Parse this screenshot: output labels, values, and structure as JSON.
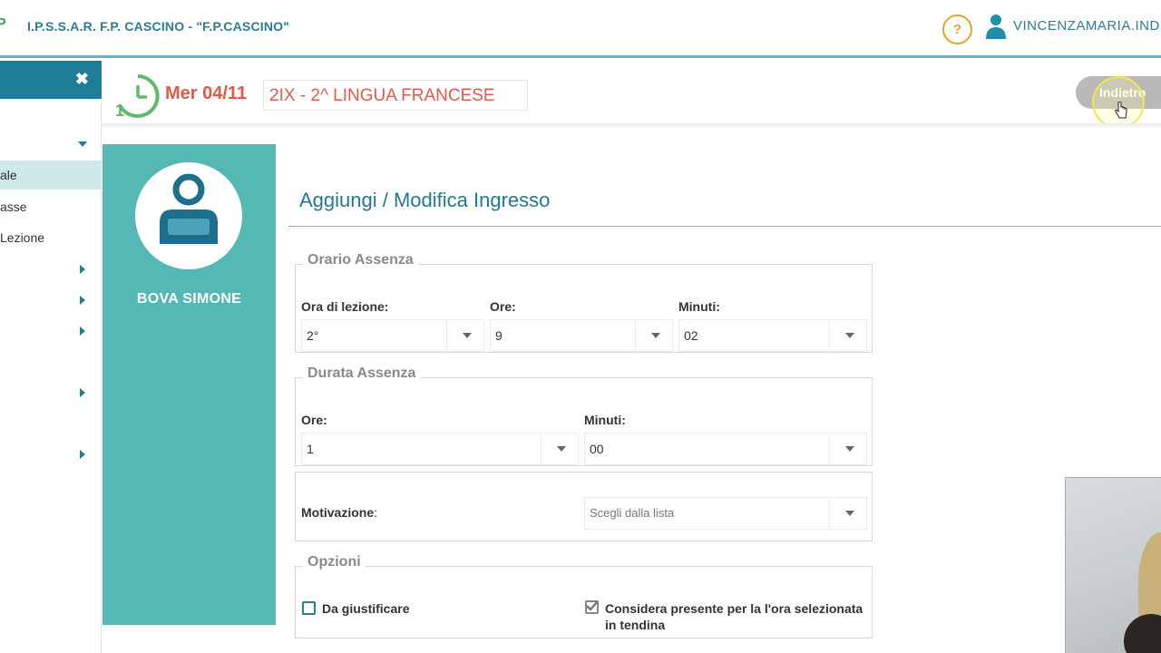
{
  "topbar": {
    "school_name": "I.P.S.S.A.R. F.P. CASCINO - \"F.P.CASCINO\"",
    "help_label": "?",
    "user_name": "VINCENZAMARIA.IND"
  },
  "sidebar": {
    "close_label": "✖",
    "items": [
      {
        "label": "ale",
        "active": true
      },
      {
        "label": "asse",
        "active": false
      },
      {
        "label": "Lezione",
        "active": false
      }
    ]
  },
  "header": {
    "date": "Mer 04/11",
    "class_name": "2IX - 2^ LINGUA FRANCESE",
    "back_label": "Indietro",
    "clock_icon": "clock-1-icon"
  },
  "student": {
    "name": "BOVA SIMONE",
    "avatar_icon": "user-avatar-icon"
  },
  "form": {
    "title": "Aggiungi / Modifica Ingresso",
    "orario": {
      "legend": "Orario Assenza",
      "lesson_label": "Ora di lezione:",
      "lesson_value": "2°",
      "hours_label": "Ore:",
      "hours_value": "9",
      "minutes_label": "Minuti:",
      "minutes_value": "02"
    },
    "durata": {
      "legend": "Durata Assenza",
      "hours_label": "Ore:",
      "hours_value": "1",
      "minutes_label": "Minuti:",
      "minutes_value": "00"
    },
    "motivazione": {
      "label": "Motivazione",
      "colon": ":",
      "placeholder": "Scegli dalla lista"
    },
    "opzioni": {
      "legend": "Opzioni",
      "to_justify_label": "Da giustificare",
      "to_justify_checked": false,
      "consider_present_label_1": "Considera presente per la l'ora selezionata",
      "consider_present_label_2": "in tendina",
      "consider_present_checked": true
    }
  },
  "colors": {
    "accent": "#1e7d97",
    "teal_panel": "#55b8b5",
    "date_red": "#e25a4a",
    "help_orange": "#e3a526"
  }
}
